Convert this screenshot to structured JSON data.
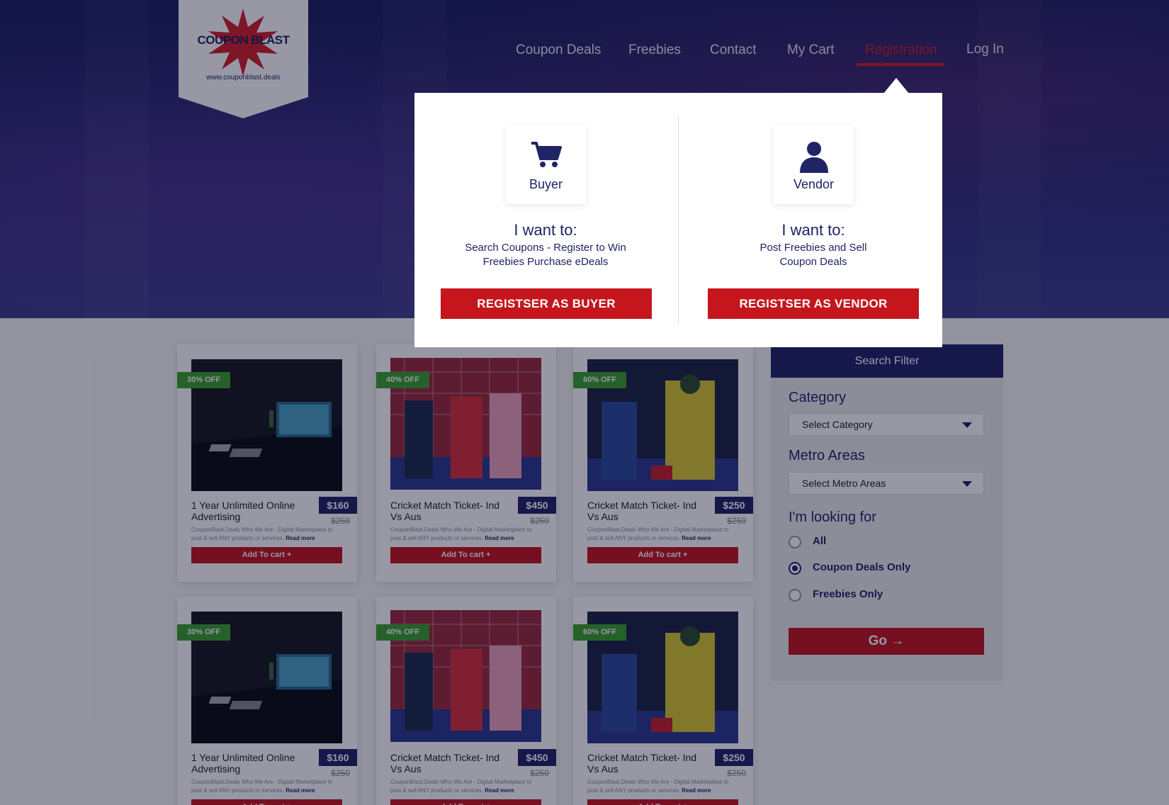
{
  "logo": {
    "title": "COUPON BLAST",
    "url": "www.couponblast.deals"
  },
  "nav": [
    {
      "label": "Coupon Deals"
    },
    {
      "label": "Freebies"
    },
    {
      "label": "Contact"
    },
    {
      "label": "My Cart"
    },
    {
      "label": "Registration"
    },
    {
      "label": "Log In"
    }
  ],
  "popup": {
    "buyer": {
      "name": "Buyer",
      "want": "I want to:",
      "desc_line1": "Search Coupons - Register to Win",
      "desc_line2": "Freebies Purchase eDeals",
      "button": "REGISTSER AS BUYER"
    },
    "vendor": {
      "name": "Vendor",
      "want": "I want to:",
      "desc_line1": "Post Freebies and Sell",
      "desc_line2": "Coupon Deals",
      "button": "REGISTSER AS VENDOR"
    }
  },
  "products": [
    {
      "badge": "30% OFF",
      "title": "1 Year Unlimited Online Advertising",
      "price": "$160",
      "old_price": "$250",
      "desc": "CouponBlast.Deals Who We Are - Digital Marketplace to post & sell ANY products or services.",
      "read_more": "Read more",
      "button": "Add To cart +"
    },
    {
      "badge": "40% OFF",
      "title": "Cricket Match Ticket- Ind  Vs Aus",
      "price": "$450",
      "old_price": "$250",
      "desc": "CouponBlast.Deals Who We Are - Digital Marketplace to post & sell ANY products or services.",
      "read_more": "Read more",
      "button": "Add To cart +"
    },
    {
      "badge": "60% OFF",
      "title": "Cricket Match Ticket- Ind  Vs Aus",
      "price": "$250",
      "old_price": "$250",
      "desc": "CouponBlast.Deals Who We Are - Digital Marketplace to post & sell ANY products or services.",
      "read_more": "Read more",
      "button": "Add To cart +"
    },
    {
      "badge": "30% OFF",
      "title": "1 Year Unlimited Online Advertising",
      "price": "$160",
      "old_price": "$250",
      "desc": "CouponBlast.Deals Who We Are - Digital Marketplace to post & sell ANY products or services.",
      "read_more": "Read more",
      "button": "Add To cart +"
    },
    {
      "badge": "40% OFF",
      "title": "Cricket Match Ticket- Ind  Vs Aus",
      "price": "$450",
      "old_price": "$250",
      "desc": "CouponBlast.Deals Who We Are - Digital Marketplace to post & sell ANY products or services.",
      "read_more": "Read more",
      "button": "Add To cart +"
    },
    {
      "badge": "60% OFF",
      "title": "Cricket Match Ticket- Ind  Vs Aus",
      "price": "$250",
      "old_price": "$250",
      "desc": "CouponBlast.Deals Who We Are - Digital Marketplace to post & sell ANY products or services.",
      "read_more": "Read more",
      "button": "Add To cart +"
    }
  ],
  "filter": {
    "title": "Search Filter",
    "category_label": "Category",
    "category_value": "Select Category",
    "metro_label": "Metro Areas",
    "metro_value": "Select Metro Areas",
    "looking_label": "I'm looking for",
    "options": [
      {
        "label": "All",
        "checked": false
      },
      {
        "label": "Coupon Deals Only",
        "checked": true
      },
      {
        "label": "Freebies Only",
        "checked": false
      }
    ],
    "go": "Go →"
  },
  "colors": {
    "navy": "#1f2466",
    "red": "#c5161d",
    "green": "#3aa02a"
  }
}
